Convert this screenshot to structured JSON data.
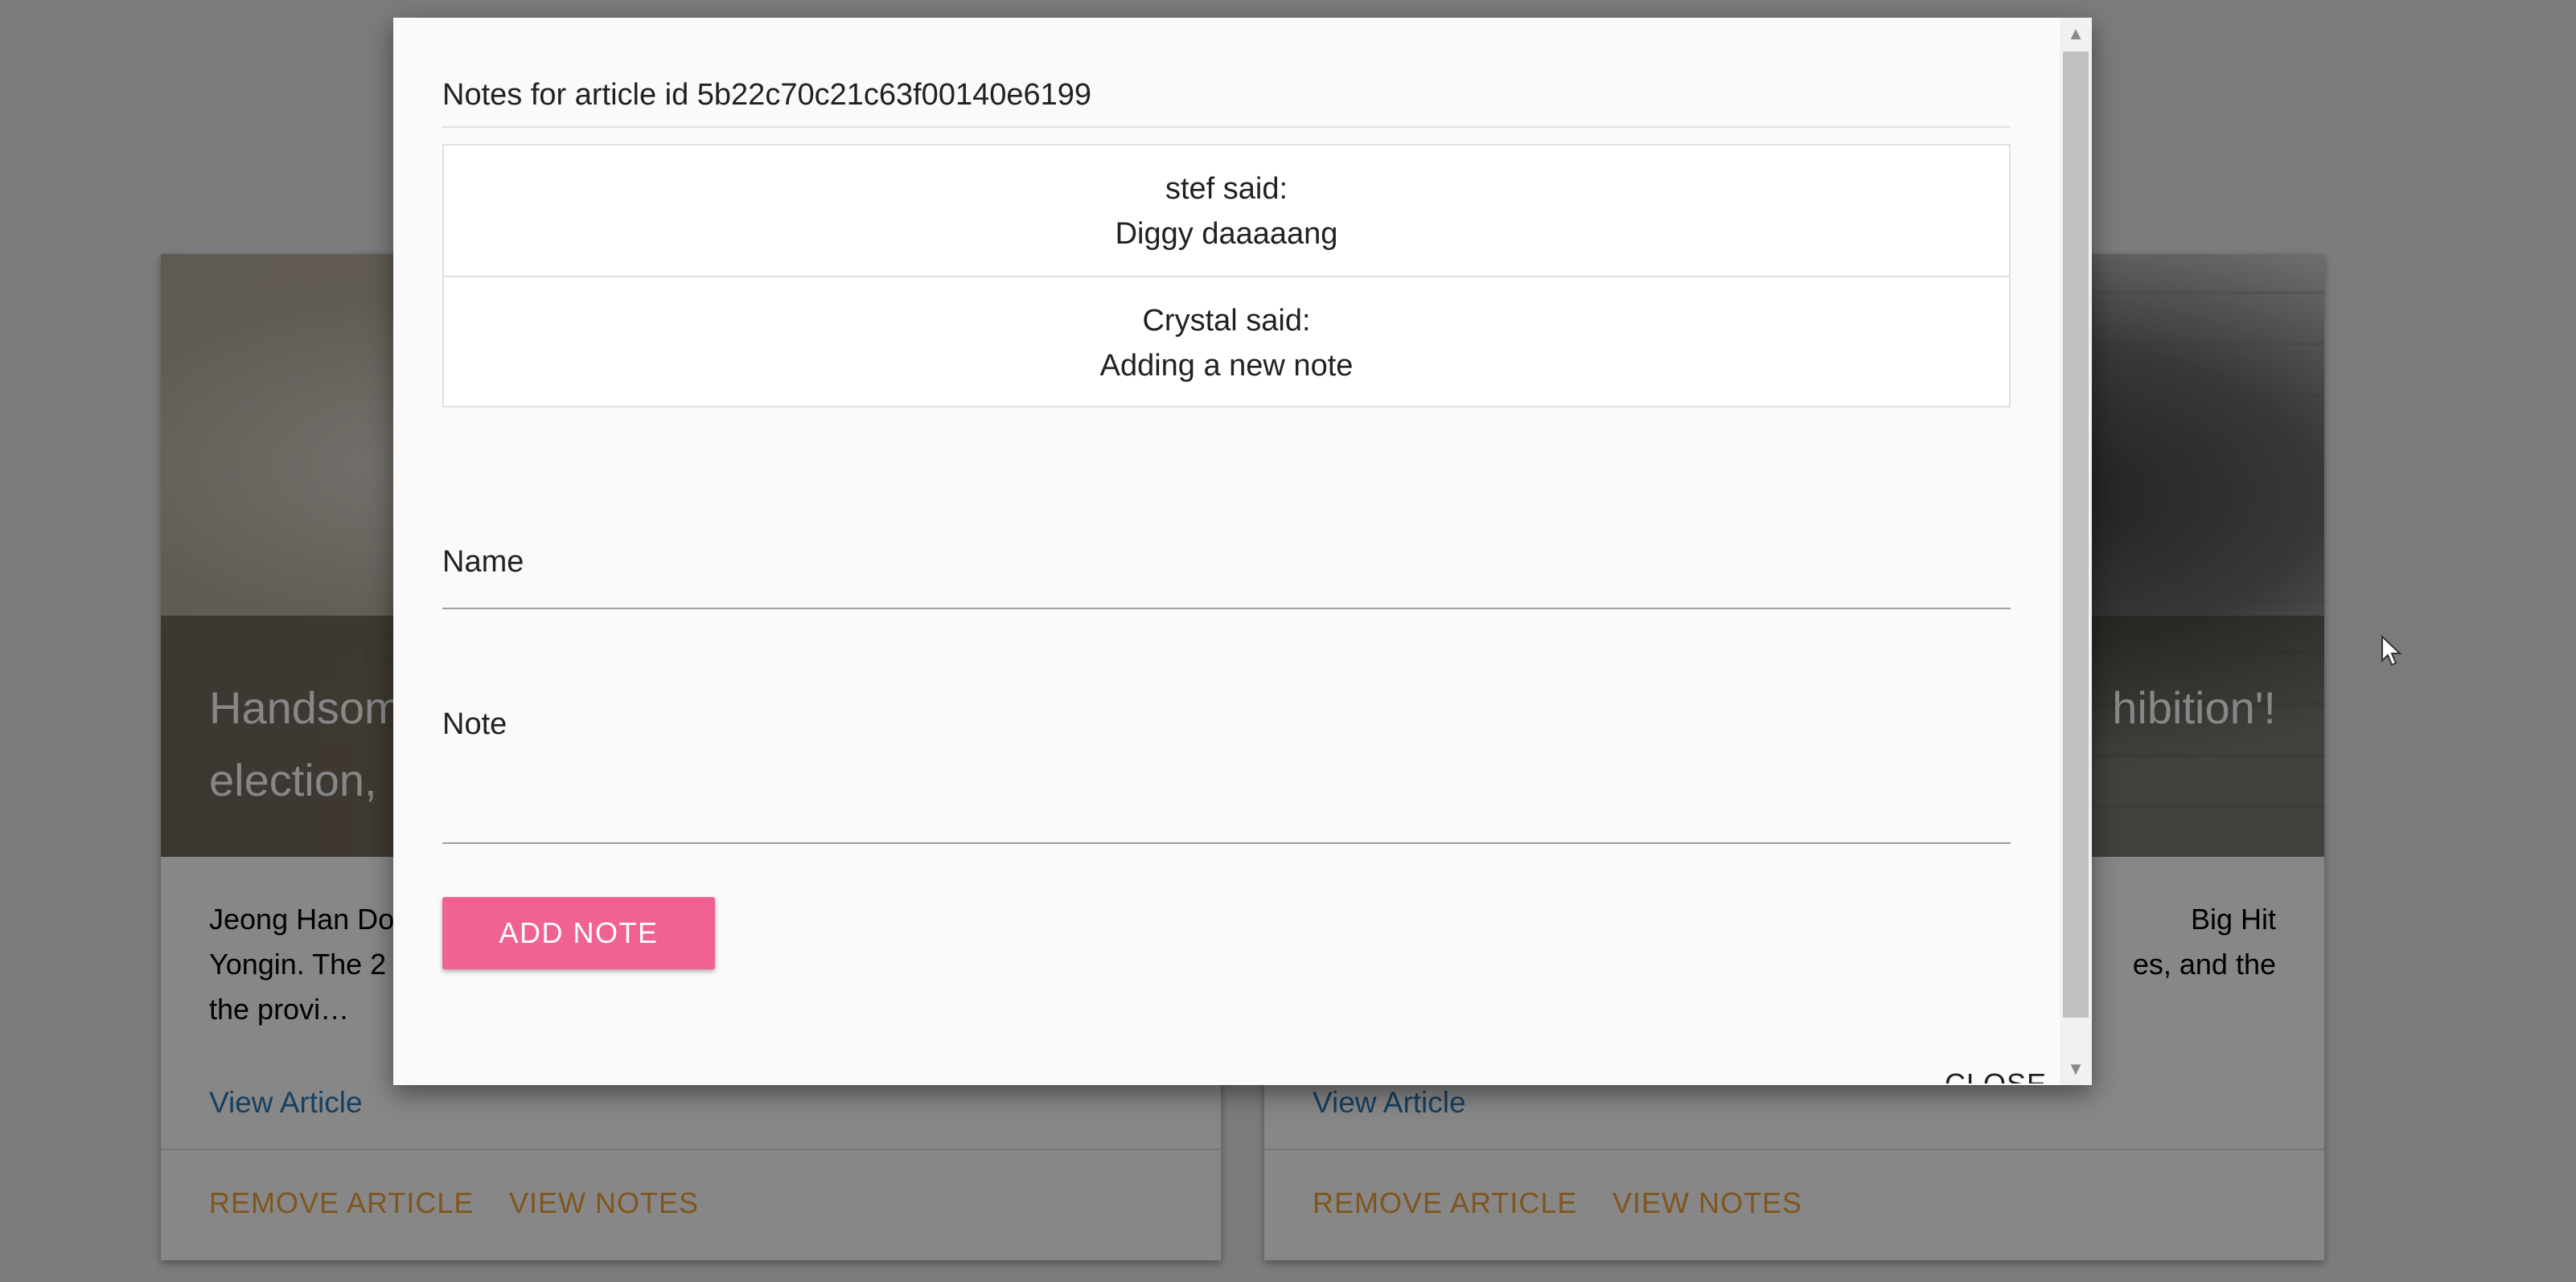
{
  "cards": [
    {
      "title": "Handsom\nelection, ",
      "body": "Jeong Han Do\nYongin. The 2\nthe provi…",
      "link": "View Article",
      "actions": [
        "REMOVE ARTICLE",
        "VIEW NOTES"
      ]
    },
    {
      "title": "hibition'!",
      "body": "Big Hit\nes, and the",
      "link": "View Article",
      "actions": [
        "REMOVE ARTICLE",
        "VIEW NOTES"
      ]
    }
  ],
  "modal": {
    "heading": "Notes for article id 5b22c70c21c63f00140e6199",
    "notes": [
      {
        "author_line": "stef said:",
        "text": "Diggy daaaaang"
      },
      {
        "author_line": "Crystal said:",
        "text": "Adding a new note"
      }
    ],
    "name_label": "Name",
    "note_label": "Note",
    "add_button": "ADD NOTE",
    "close_button": "CLOSE"
  },
  "icons": {
    "scroll_up": "triangle-up",
    "scroll_down": "triangle-down",
    "cursor": "mouse-pointer"
  },
  "colors": {
    "accent_button": "#f06292",
    "action_link": "#f0a23c",
    "view_link": "#2a7ab8"
  }
}
